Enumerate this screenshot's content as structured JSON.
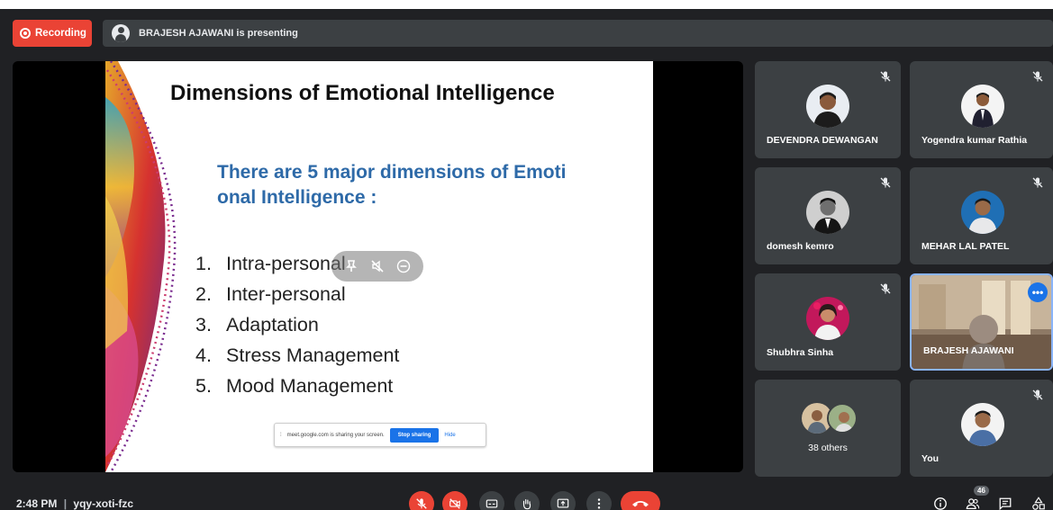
{
  "topbar": {
    "recording_label": "Recording",
    "presenting_text": "BRAJESH AJAWANI is presenting"
  },
  "slide": {
    "title": "Dimensions of Emotional Intelligence",
    "subtitle_line1": "There are 5 major dimensions of Emoti",
    "subtitle_line2": "onal Intelligence :",
    "items": [
      {
        "num": "1.",
        "label": "Intra-personal"
      },
      {
        "num": "2.",
        "label": "Inter-personal"
      },
      {
        "num": "3.",
        "label": "Adaptation"
      },
      {
        "num": "4.",
        "label": "Stress Management"
      },
      {
        "num": "5.",
        "label": "Mood Management"
      }
    ],
    "share_banner": {
      "text": "meet.google.com is sharing your screen.",
      "stop_label": "Stop sharing",
      "hide_label": "Hide"
    }
  },
  "participants": [
    {
      "name": "DEVENDRA DEWANGAN",
      "muted": true
    },
    {
      "name": "Yogendra kumar Rathia",
      "muted": true
    },
    {
      "name": "domesh kemro",
      "muted": true
    },
    {
      "name": "MEHAR LAL PATEL",
      "muted": true
    },
    {
      "name": "Shubhra Sinha",
      "muted": true
    },
    {
      "name": "BRAJESH AJAWANI",
      "muted": false
    },
    {
      "name": "38 others",
      "muted": false
    },
    {
      "name": "You",
      "muted": true
    }
  ],
  "bottombar": {
    "time": "2:48 PM",
    "separator": "|",
    "meeting_code": "yqy-xoti-fzc",
    "people_count": "46"
  },
  "colors": {
    "background": "#202124",
    "tile": "#3c4043",
    "danger": "#ea4335",
    "accent": "#1a73e8",
    "slide_subtitle": "#2e6aa8"
  },
  "icons": [
    "record-icon",
    "mic-off-icon",
    "cam-off-icon",
    "captions-icon",
    "raise-hand-icon",
    "present-icon",
    "more-vert-icon",
    "end-call-icon",
    "info-icon",
    "people-icon",
    "chat-icon",
    "activities-icon"
  ]
}
